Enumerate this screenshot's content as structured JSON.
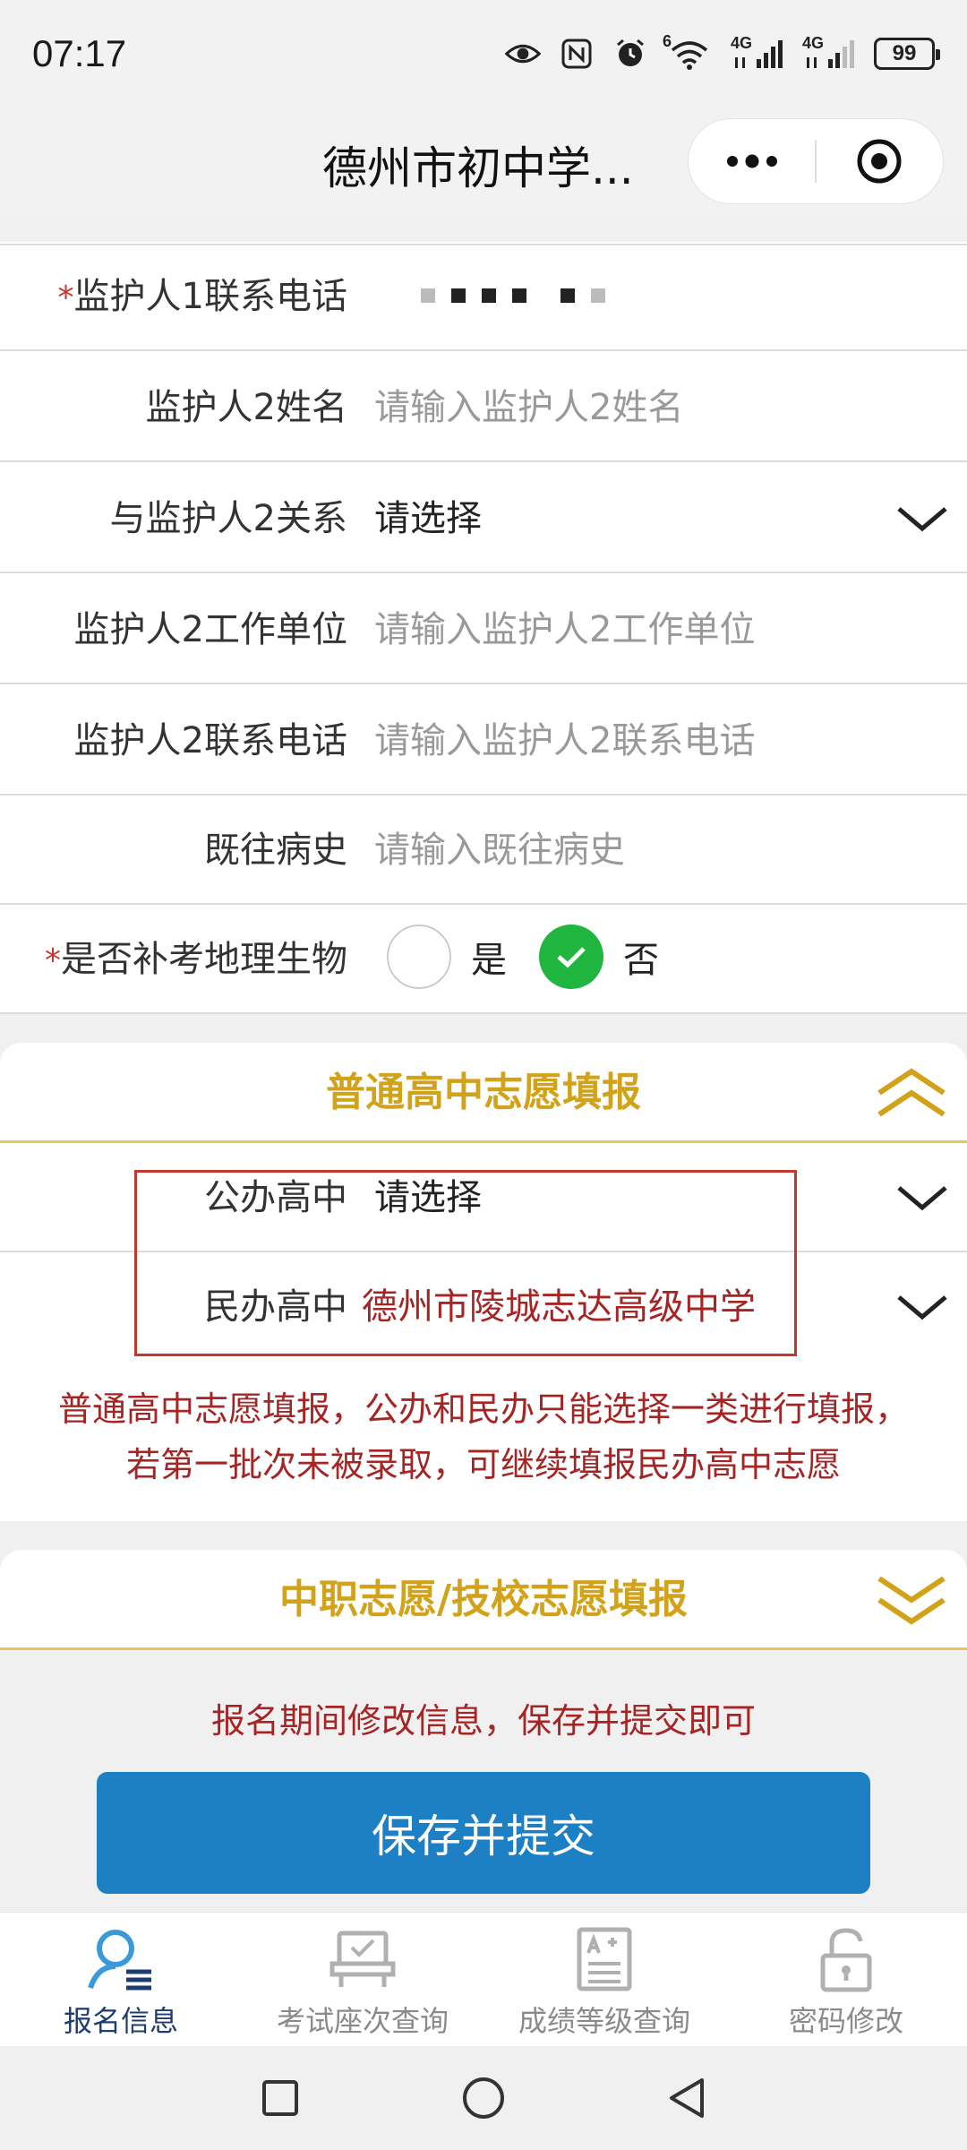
{
  "status_bar": {
    "time": "07:17",
    "signal1_label": "4G",
    "signal2_label": "4G",
    "wifi_label": "6",
    "battery": "99"
  },
  "header": {
    "title": "德州市初中学..."
  },
  "form": {
    "guardian1_phone": {
      "label": "监护人1联系电话"
    },
    "guardian2_name": {
      "label": "监护人2姓名",
      "placeholder": "请输入监护人2姓名"
    },
    "guardian2_relation": {
      "label": "与监护人2关系",
      "value": "请选择"
    },
    "guardian2_work": {
      "label": "监护人2工作单位",
      "placeholder": "请输入监护人2工作单位"
    },
    "guardian2_phone": {
      "label": "监护人2联系电话",
      "placeholder": "请输入监护人2联系电话"
    },
    "medical_history": {
      "label": "既往病史",
      "placeholder": "请输入既往病史"
    },
    "makeup_exam": {
      "label": "是否补考地理生物",
      "option_yes": "是",
      "option_no": "否",
      "selected": "否"
    },
    "required_mark": "*"
  },
  "section_high_school": {
    "title": "普通高中志愿填报",
    "public": {
      "label": "公办高中",
      "value": "请选择"
    },
    "private": {
      "label": "民办高中",
      "value": "德州市陵城志达高级中学"
    },
    "notice_line1": "普通高中志愿填报，公办和民办只能选择一类进行填报，",
    "notice_line2": "若第一批次未被录取，可继续填报民办高中志愿"
  },
  "section_vocational": {
    "title": "中职志愿/技校志愿填报"
  },
  "info_text": "报名期间修改信息，保存并提交即可",
  "submit_label": "保存并提交",
  "tabs": [
    {
      "label": "报名信息",
      "icon": "person-list-icon",
      "active": true
    },
    {
      "label": "考试座次查询",
      "icon": "seat-icon",
      "active": false
    },
    {
      "label": "成绩等级查询",
      "icon": "grade-doc-icon",
      "active": false
    },
    {
      "label": "密码修改",
      "icon": "lock-icon",
      "active": false
    }
  ],
  "colors": {
    "accent_gold": "#d2a31a",
    "notice_red": "#a52525",
    "button_blue": "#1d80c4",
    "check_green": "#1fb53f"
  }
}
